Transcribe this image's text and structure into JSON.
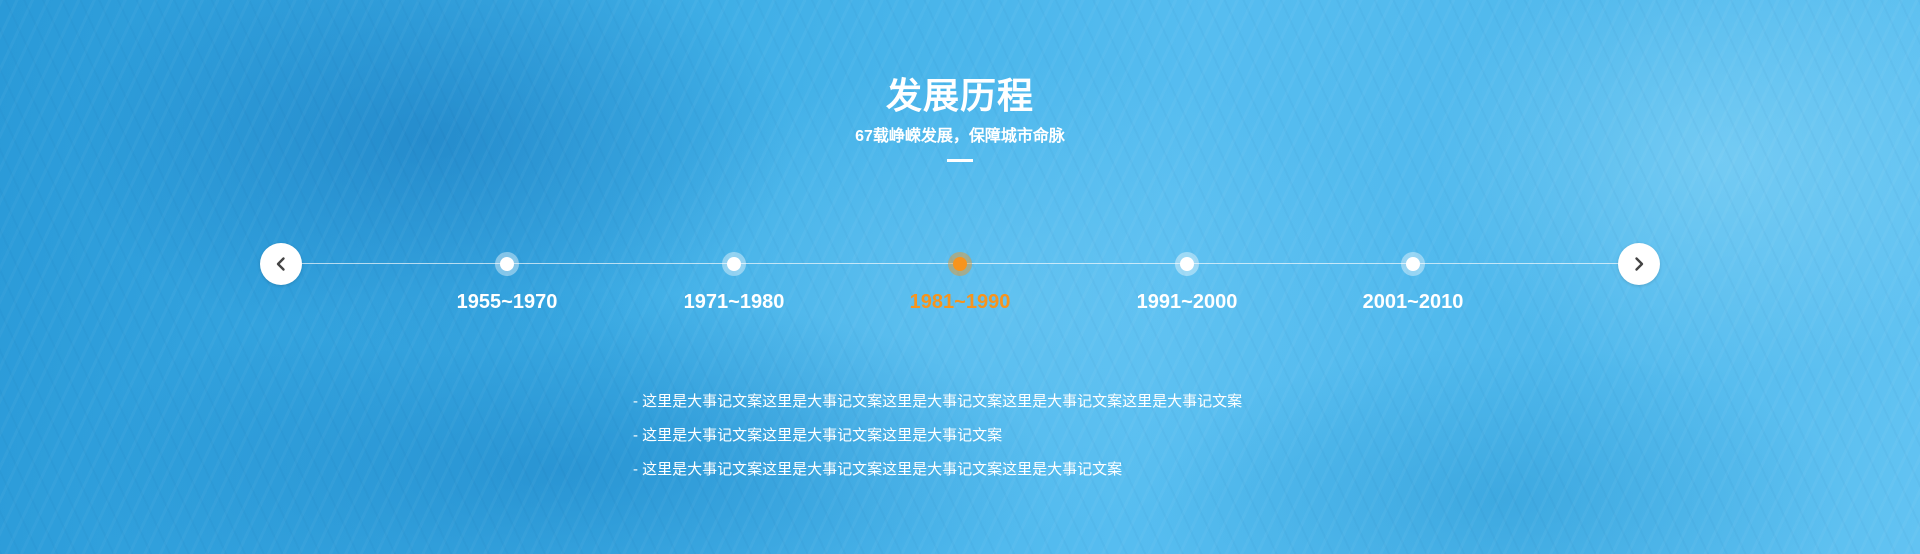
{
  "section": {
    "title": "发展历程",
    "subtitle": "67载峥嵘发展，保障城市命脉"
  },
  "timeline": {
    "prev_icon": "chevron-left-icon",
    "next_icon": "chevron-right-icon",
    "active_color": "#f7941d",
    "periods": [
      {
        "label": "1955~1970",
        "active": false
      },
      {
        "label": "1971~1980",
        "active": false
      },
      {
        "label": "1981~1990",
        "active": true
      },
      {
        "label": "1991~2000",
        "active": false
      },
      {
        "label": "2001~2010",
        "active": false
      }
    ]
  },
  "events": [
    "- 这里是大事记文案这里是大事记文案这里是大事记文案这里是大事记文案这里是大事记文案",
    "- 这里是大事记文案这里是大事记文案这里是大事记文案",
    "- 这里是大事记文案这里是大事记文案这里是大事记文案这里是大事记文案"
  ],
  "colors": {
    "background": "#3eaee6",
    "text": "#ffffff",
    "accent": "#f7941d"
  }
}
